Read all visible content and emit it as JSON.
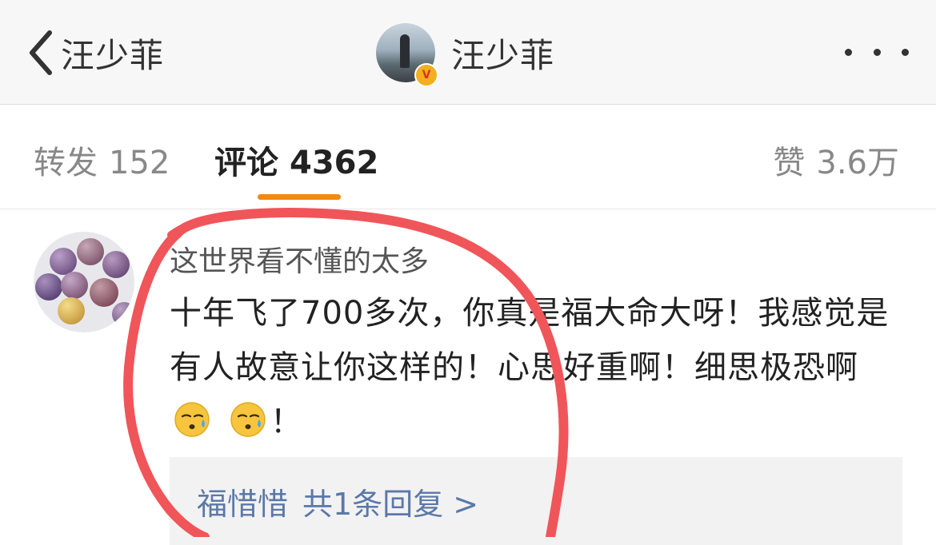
{
  "nav": {
    "back_label": "汪少菲",
    "title": "汪少菲",
    "verified_badge": "V"
  },
  "tabs": {
    "repost_label": "转发",
    "repost_count": "152",
    "comment_label": "评论",
    "comment_count": "4362",
    "like_label": "赞",
    "like_count": "3.6万"
  },
  "comment": {
    "username": "这世界看不懂的太多",
    "text": "十年飞了700多次，你真是福大命大呀！我感觉是有人故意让你这样的！心思好重啊！细思极恐啊",
    "trailing": "！",
    "emojis": [
      "sweat-face-icon",
      "sweat-face-icon"
    ],
    "reply_user": "福惜惜",
    "reply_summary": "共1条回复 >"
  },
  "colors": {
    "accent_orange": "#f08a10",
    "link_blue": "#5b78a8",
    "annotation_red": "#f0555a"
  }
}
